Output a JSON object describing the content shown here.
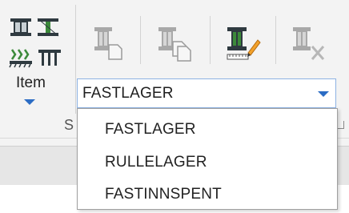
{
  "ribbon": {
    "item_label": "Item",
    "group_label": "S",
    "support_type": {
      "selected_value": "FASTLAGER",
      "options": [
        "FASTLAGER",
        "RULLELAGER",
        "FASTINNSPENT"
      ]
    },
    "icons": [
      "column-icon",
      "column-split-icon",
      "fixed-support-icon",
      "roller-support-icon",
      "column-page-icon",
      "column-copy-icon",
      "column-edit-icon",
      "column-delete-icon"
    ]
  },
  "colors": {
    "accent": "#2b6cc4",
    "icon_dark": "#2f3a40",
    "icon_green": "#3c8a3a",
    "delete_red": "#b7b7b7"
  }
}
